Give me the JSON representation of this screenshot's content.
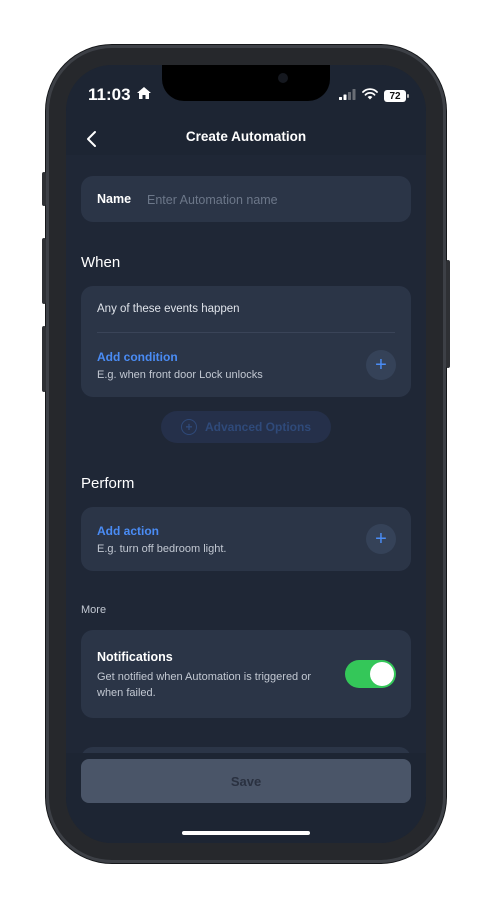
{
  "status_bar": {
    "time": "11:03",
    "battery": "72",
    "icons": [
      "home-icon",
      "signal-icon",
      "wifi-icon",
      "battery-icon"
    ]
  },
  "nav": {
    "title": "Create Automation",
    "back_icon": "chevron-left-icon"
  },
  "name_field": {
    "label": "Name",
    "placeholder": "Enter Automation name",
    "value": ""
  },
  "when": {
    "title": "When",
    "events_text": "Any of these events happen",
    "add_label": "Add condition",
    "hint": "E.g. when front door Lock unlocks"
  },
  "advanced_options": {
    "label": "Advanced Options"
  },
  "perform": {
    "title": "Perform",
    "add_label": "Add action",
    "hint": "E.g. turn off bedroom light."
  },
  "more": {
    "label": "More"
  },
  "notifications": {
    "title": "Notifications",
    "description": "Get notified when Automation is triggered or when failed.",
    "enabled": true
  },
  "save": {
    "label": "Save"
  },
  "colors": {
    "accent": "#4a8cf5",
    "toggle_on": "#34c759",
    "background": "#1f2736",
    "card": "#2b3547"
  }
}
